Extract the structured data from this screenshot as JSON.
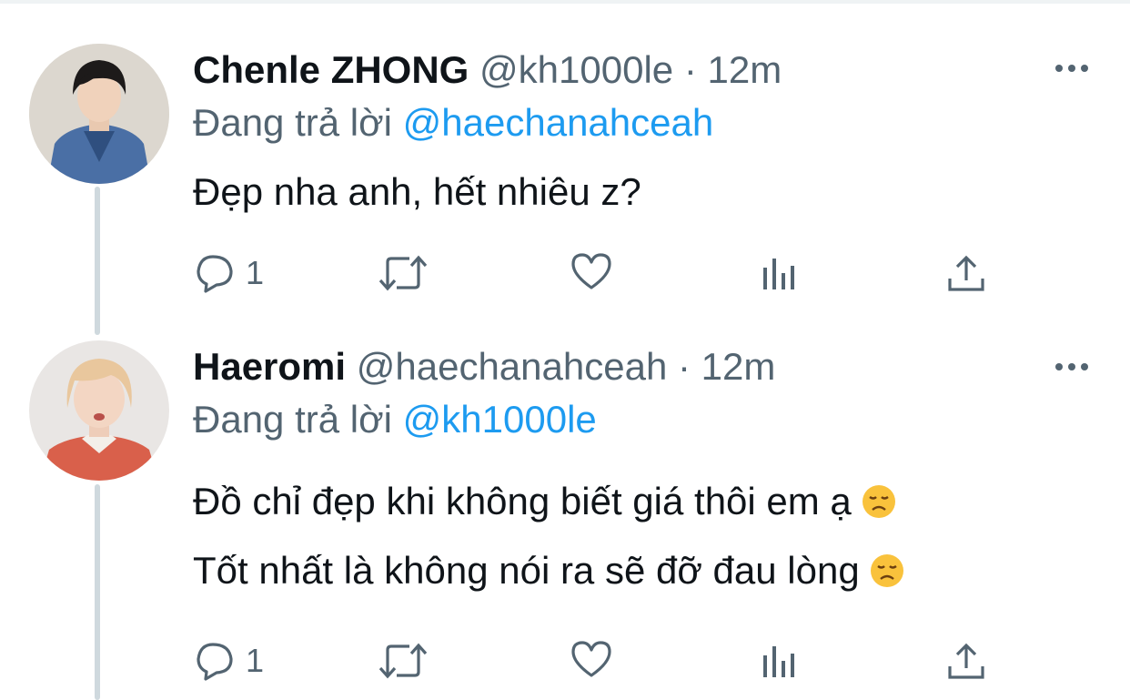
{
  "tweets": [
    {
      "name": "Chenle ZHONG",
      "handle": "@kh1000le",
      "separator": "·",
      "time": "12m",
      "reply_prefix": "Đang trả lời",
      "reply_to": "@haechanahceah",
      "lines": [
        "Đẹp nha anh, hết nhiêu z?"
      ],
      "reply_count": "1"
    },
    {
      "name": "Haeromi",
      "handle": "@haechanahceah",
      "separator": "·",
      "time": "12m",
      "reply_prefix": "Đang trả lời",
      "reply_to": "@kh1000le",
      "lines": [
        "Đồ chỉ đẹp khi không biết giá thôi em ạ",
        "Tốt nhất là không nói ra sẽ đỡ đau lòng"
      ],
      "reply_count": "1"
    }
  ],
  "icons": {
    "reply": "comment-bubble-icon",
    "retweet": "retweet-icon",
    "like": "heart-icon",
    "analytics": "bar-chart-icon",
    "share": "share-upload-icon",
    "more": "more-dots-icon",
    "emoji": "disappointed-face-emoji"
  },
  "colors": {
    "text": "#0f1419",
    "secondary": "#536471",
    "link": "#1d9bf0",
    "thread_line": "#cfd9de"
  }
}
